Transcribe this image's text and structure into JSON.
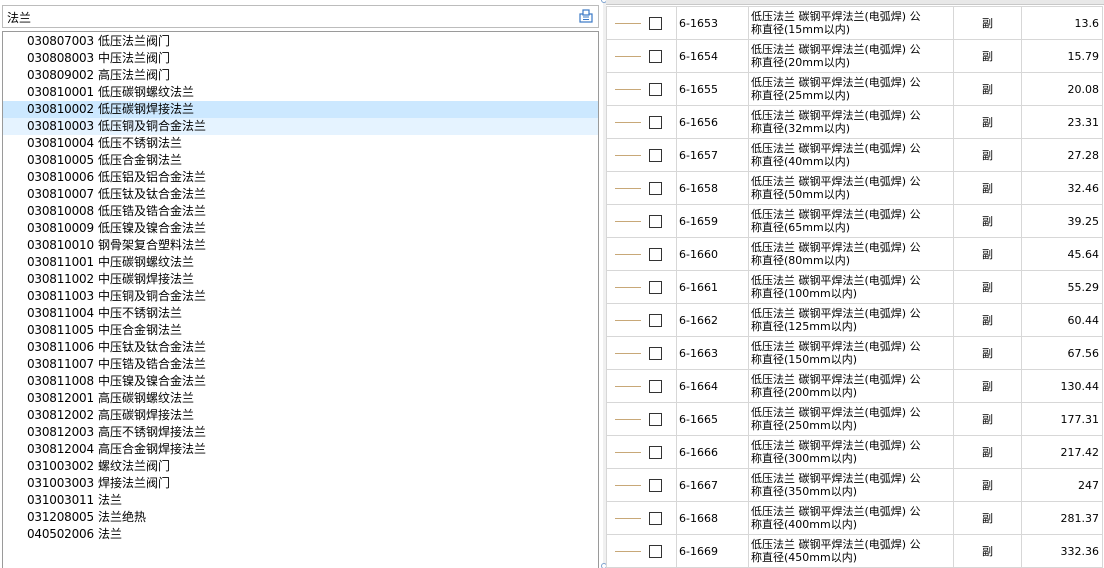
{
  "search": {
    "value": "法兰"
  },
  "code_list": [
    {
      "code": "030807003",
      "name": "低压法兰阀门"
    },
    {
      "code": "030808003",
      "name": "中压法兰阀门"
    },
    {
      "code": "030809002",
      "name": "高压法兰阀门"
    },
    {
      "code": "030810001",
      "name": "低压碳钢螺纹法兰"
    },
    {
      "code": "030810002",
      "name": "低压碳钢焊接法兰",
      "state": "selected"
    },
    {
      "code": "030810003",
      "name": "低压铜及铜合金法兰",
      "state": "hover"
    },
    {
      "code": "030810004",
      "name": "低压不锈钢法兰"
    },
    {
      "code": "030810005",
      "name": "低压合金钢法兰"
    },
    {
      "code": "030810006",
      "name": "低压铝及铝合金法兰"
    },
    {
      "code": "030810007",
      "name": "低压钛及钛合金法兰"
    },
    {
      "code": "030810008",
      "name": "低压锆及锆合金法兰"
    },
    {
      "code": "030810009",
      "name": "低压镍及镍合金法兰"
    },
    {
      "code": "030810010",
      "name": "钢骨架复合塑料法兰"
    },
    {
      "code": "030811001",
      "name": "中压碳钢螺纹法兰"
    },
    {
      "code": "030811002",
      "name": "中压碳钢焊接法兰"
    },
    {
      "code": "030811003",
      "name": "中压铜及铜合金法兰"
    },
    {
      "code": "030811004",
      "name": "中压不锈钢法兰"
    },
    {
      "code": "030811005",
      "name": "中压合金钢法兰"
    },
    {
      "code": "030811006",
      "name": "中压钛及钛合金法兰"
    },
    {
      "code": "030811007",
      "name": "中压锆及锆合金法兰"
    },
    {
      "code": "030811008",
      "name": "中压镍及镍合金法兰"
    },
    {
      "code": "030812001",
      "name": "高压碳钢螺纹法兰"
    },
    {
      "code": "030812002",
      "name": "高压碳钢焊接法兰"
    },
    {
      "code": "030812003",
      "name": "高压不锈钢焊接法兰"
    },
    {
      "code": "030812004",
      "name": "高压合金钢焊接法兰"
    },
    {
      "code": "031003002",
      "name": "螺纹法兰阀门"
    },
    {
      "code": "031003003",
      "name": "焊接法兰阀门"
    },
    {
      "code": "031003011",
      "name": "法兰"
    },
    {
      "code": "031208005",
      "name": "法兰绝热"
    },
    {
      "code": "040502006",
      "name": "法兰"
    }
  ],
  "quota_rows": [
    {
      "code": "6-1653",
      "line1": "低压法兰 碳钢平焊法兰(电弧焊) 公",
      "line2": "称直径(15mm以内)",
      "unit": "副",
      "price": "13.6"
    },
    {
      "code": "6-1654",
      "line1": "低压法兰 碳钢平焊法兰(电弧焊) 公",
      "line2": "称直径(20mm以内)",
      "unit": "副",
      "price": "15.79"
    },
    {
      "code": "6-1655",
      "line1": "低压法兰 碳钢平焊法兰(电弧焊) 公",
      "line2": "称直径(25mm以内)",
      "unit": "副",
      "price": "20.08"
    },
    {
      "code": "6-1656",
      "line1": "低压法兰 碳钢平焊法兰(电弧焊) 公",
      "line2": "称直径(32mm以内)",
      "unit": "副",
      "price": "23.31"
    },
    {
      "code": "6-1657",
      "line1": "低压法兰 碳钢平焊法兰(电弧焊) 公",
      "line2": "称直径(40mm以内)",
      "unit": "副",
      "price": "27.28"
    },
    {
      "code": "6-1658",
      "line1": "低压法兰 碳钢平焊法兰(电弧焊) 公",
      "line2": "称直径(50mm以内)",
      "unit": "副",
      "price": "32.46"
    },
    {
      "code": "6-1659",
      "line1": "低压法兰 碳钢平焊法兰(电弧焊) 公",
      "line2": "称直径(65mm以内)",
      "unit": "副",
      "price": "39.25"
    },
    {
      "code": "6-1660",
      "line1": "低压法兰 碳钢平焊法兰(电弧焊) 公",
      "line2": "称直径(80mm以内)",
      "unit": "副",
      "price": "45.64"
    },
    {
      "code": "6-1661",
      "line1": "低压法兰 碳钢平焊法兰(电弧焊) 公",
      "line2": "称直径(100mm以内)",
      "unit": "副",
      "price": "55.29"
    },
    {
      "code": "6-1662",
      "line1": "低压法兰 碳钢平焊法兰(电弧焊) 公",
      "line2": "称直径(125mm以内)",
      "unit": "副",
      "price": "60.44"
    },
    {
      "code": "6-1663",
      "line1": "低压法兰 碳钢平焊法兰(电弧焊) 公",
      "line2": "称直径(150mm以内)",
      "unit": "副",
      "price": "67.56"
    },
    {
      "code": "6-1664",
      "line1": "低压法兰 碳钢平焊法兰(电弧焊) 公",
      "line2": "称直径(200mm以内)",
      "unit": "副",
      "price": "130.44"
    },
    {
      "code": "6-1665",
      "line1": "低压法兰 碳钢平焊法兰(电弧焊) 公",
      "line2": "称直径(250mm以内)",
      "unit": "副",
      "price": "177.31"
    },
    {
      "code": "6-1666",
      "line1": "低压法兰 碳钢平焊法兰(电弧焊) 公",
      "line2": "称直径(300mm以内)",
      "unit": "副",
      "price": "217.42"
    },
    {
      "code": "6-1667",
      "line1": "低压法兰 碳钢平焊法兰(电弧焊) 公",
      "line2": "称直径(350mm以内)",
      "unit": "副",
      "price": "247"
    },
    {
      "code": "6-1668",
      "line1": "低压法兰 碳钢平焊法兰(电弧焊) 公",
      "line2": "称直径(400mm以内)",
      "unit": "副",
      "price": "281.37"
    },
    {
      "code": "6-1669",
      "line1": "低压法兰 碳钢平焊法兰(电弧焊) 公",
      "line2": "称直径(450mm以内)",
      "unit": "副",
      "price": "332.36"
    }
  ],
  "icons": {
    "search": "search-icon",
    "checkbox": "checkbox-icon"
  },
  "colors": {
    "selected_row": "#cce8ff",
    "hover_row": "#e5f3ff",
    "tree_line": "#c8a878"
  }
}
